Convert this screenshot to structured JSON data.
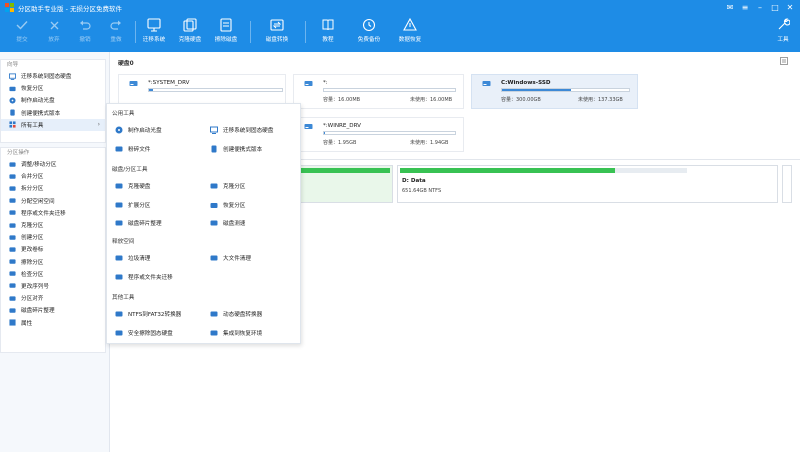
{
  "app": {
    "title": "分区助手专业版 - 无损分区免费软件"
  },
  "toolbar": {
    "commit": "提交",
    "undo": "放弃",
    "redo": "撤销",
    "redo2": "重做",
    "migrate": "迁移系统",
    "clone": "克隆硬盘",
    "wipe": "擦除磁盘",
    "convert": "磁盘转换",
    "tutorial": "教程",
    "backup": "免费备份",
    "data_recovery": "数据恢复",
    "tools": "工具"
  },
  "sidebar": {
    "guide_header": "向导",
    "guide_items": [
      {
        "label": "迁移系统到固态硬盘",
        "icon": "migrate-icon"
      },
      {
        "label": "恢复分区",
        "icon": "restore-icon"
      },
      {
        "label": "制作启动光盘",
        "icon": "bootdisk-icon"
      },
      {
        "label": "创建便携式版本",
        "icon": "portable-icon"
      },
      {
        "label": "所有工具",
        "icon": "grid-icon"
      }
    ],
    "ops_header": "分区操作",
    "ops_items": [
      {
        "label": "调整/移动分区",
        "icon": "resize-icon"
      },
      {
        "label": "合并分区",
        "icon": "merge-icon"
      },
      {
        "label": "拆分分区",
        "icon": "split-icon"
      },
      {
        "label": "分配空闲空间",
        "icon": "allocate-icon"
      },
      {
        "label": "程序或文件夹迁移",
        "icon": "move-app-icon"
      },
      {
        "label": "克隆分区",
        "icon": "clone-icon"
      },
      {
        "label": "创建分区",
        "icon": "create-icon"
      },
      {
        "label": "更改卷标",
        "icon": "label-icon"
      },
      {
        "label": "擦除分区",
        "icon": "wipe-icon"
      },
      {
        "label": "检查分区",
        "icon": "check-icon"
      },
      {
        "label": "更改序列号",
        "icon": "serial-icon"
      },
      {
        "label": "分区对齐",
        "icon": "align-icon"
      },
      {
        "label": "磁盘碎片整理",
        "icon": "defrag-icon"
      },
      {
        "label": "属性",
        "icon": "properties-icon"
      }
    ]
  },
  "main": {
    "disk_label": "硬盘0",
    "cards": [
      {
        "name": "*:SYSTEM_DRV",
        "capacity": "",
        "free": "",
        "fill": 0.03
      },
      {
        "name": "*:",
        "capacity": "容量：16.00MB",
        "free": "未使用：16.00MB",
        "fill": 0
      },
      {
        "name": "C:Windows-SSD",
        "capacity": "容量：300.00GB",
        "free": "未使用：137.33GB",
        "fill": 0.54
      },
      {
        "name": "*:WINRE_DRV",
        "capacity": "容量：1.95GB",
        "free": "未使用：1.94GB",
        "fill": 0.01
      }
    ],
    "segments": [
      {
        "name": "D: Data",
        "info": "651.64GB NTFS",
        "fill": 0.75
      }
    ]
  },
  "popup": {
    "groups": [
      {
        "title": "公用工具",
        "items": [
          {
            "label": "制作启动光盘",
            "icon": "bootdisk-icon"
          },
          {
            "label": "迁移系统到固态硬盘",
            "icon": "migrate-icon"
          },
          {
            "label": "粉碎文件",
            "icon": "shred-icon"
          },
          {
            "label": "创建便携式版本",
            "icon": "portable-icon"
          }
        ]
      },
      {
        "title": "磁盘/分区工具",
        "items": [
          {
            "label": "克隆硬盘",
            "icon": "clone-disk-icon"
          },
          {
            "label": "克隆分区",
            "icon": "clone-partition-icon"
          },
          {
            "label": "扩展分区",
            "icon": "extend-icon"
          },
          {
            "label": "恢复分区",
            "icon": "restore-icon"
          },
          {
            "label": "磁盘碎片整理",
            "icon": "defrag-icon"
          },
          {
            "label": "磁盘测速",
            "icon": "speed-icon"
          }
        ]
      },
      {
        "title": "释放空间",
        "items": [
          {
            "label": "垃圾清理",
            "icon": "cleanup-icon"
          },
          {
            "label": "大文件清理",
            "icon": "large-file-icon"
          },
          {
            "label": "程序或文件夹迁移",
            "icon": "move-app-icon"
          }
        ]
      },
      {
        "title": "其他工具",
        "items": [
          {
            "label": "NTFS到FAT32转换器",
            "icon": "ntfs-fat-icon"
          },
          {
            "label": "动态硬盘转换器",
            "icon": "dynamic-disk-icon"
          },
          {
            "label": "安全擦除固态硬盘",
            "icon": "secure-erase-icon"
          },
          {
            "label": "集成到恢复环境",
            "icon": "recovery-env-icon"
          }
        ]
      }
    ]
  },
  "colors": {
    "accent": "#1e8ce6",
    "bar": "#3d89d6",
    "green": "#38c253"
  }
}
